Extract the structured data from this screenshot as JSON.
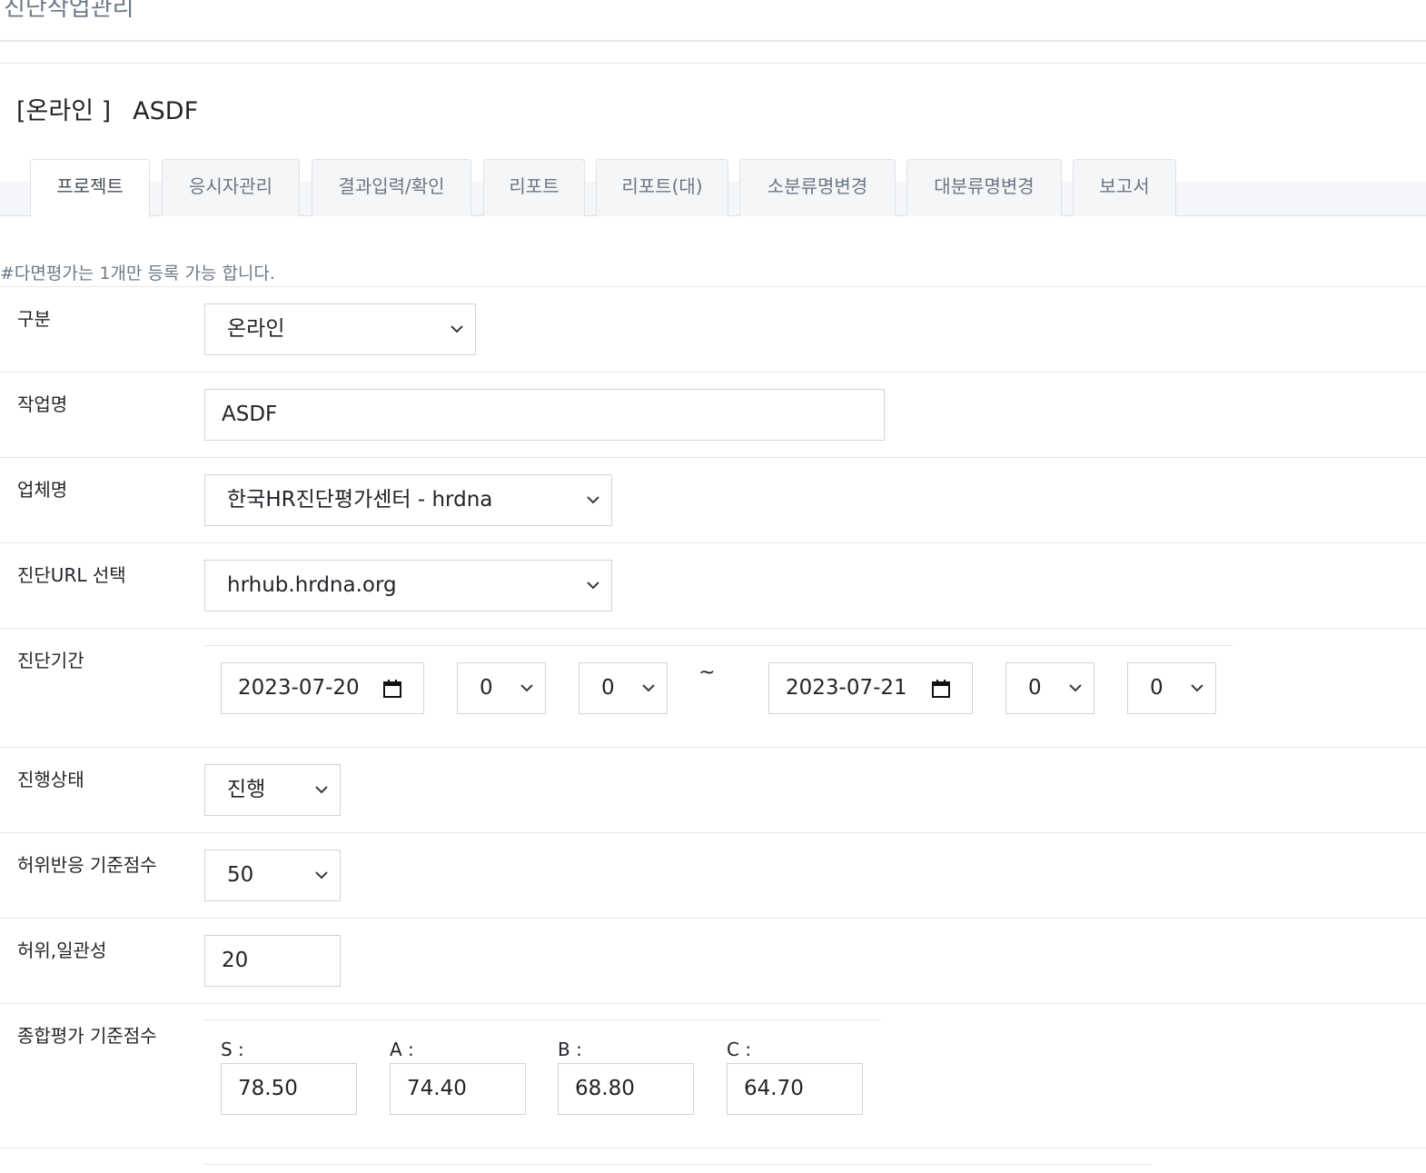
{
  "page": {
    "title": "진단작업관리"
  },
  "project": {
    "kind": "[온라인 ]",
    "name": "ASDF"
  },
  "tabs": [
    {
      "label": "프로젝트",
      "active": true
    },
    {
      "label": "응시자관리"
    },
    {
      "label": "결과입력/확인"
    },
    {
      "label": "리포트"
    },
    {
      "label": "리포트(대)"
    },
    {
      "label": "소분류명변경"
    },
    {
      "label": "대분류명변경"
    },
    {
      "label": "보고서"
    }
  ],
  "notice": "#다면평가는 1개만 등록 가능 합니다.",
  "form": {
    "category": {
      "label": "구분",
      "value": "온라인"
    },
    "job_name": {
      "label": "작업명",
      "value": "ASDF"
    },
    "company": {
      "label": "업체명",
      "value": "한국HR진단평가센터 - hrdna"
    },
    "url": {
      "label": "진단URL 선택",
      "value": "hrhub.hrdna.org"
    },
    "period": {
      "label": "진단기간",
      "start_date": "2023-07-20",
      "start_hour": "0",
      "start_minute": "0",
      "separator": "~",
      "end_date": "2023-07-21",
      "end_hour": "0",
      "end_minute": "0"
    },
    "status": {
      "label": "진행상태",
      "value": "진행"
    },
    "false_response": {
      "label": "허위반응 기준점수",
      "value": "50"
    },
    "consistency": {
      "label": "허위,일관성",
      "value": "20"
    },
    "overall": {
      "label": "종합평가 기준점수",
      "grades": [
        {
          "name": "S :",
          "value": "78.50"
        },
        {
          "name": "A :",
          "value": "74.40"
        },
        {
          "name": "B :",
          "value": "68.80"
        },
        {
          "name": "C :",
          "value": "64.70"
        }
      ]
    }
  },
  "icons": {
    "select": "chevron-down-icon",
    "date": "calendar-icon"
  }
}
